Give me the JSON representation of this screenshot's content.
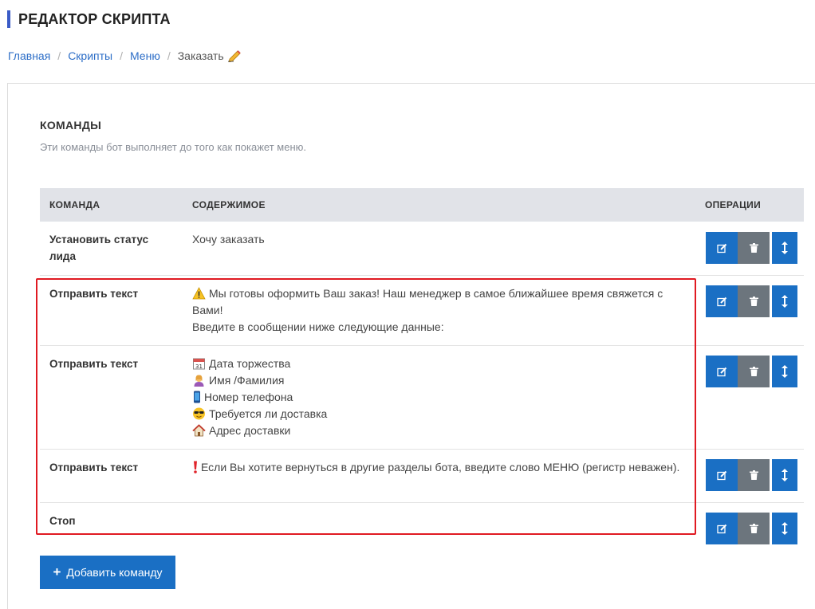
{
  "page": {
    "title": "РЕДАКТОР СКРИПТА"
  },
  "breadcrumb": {
    "items": [
      "Главная",
      "Скрипты",
      "Меню"
    ],
    "current": "Заказать",
    "current_icon": "writing-hand-icon"
  },
  "section": {
    "title": "КОМАНДЫ",
    "description": "Эти команды бот выполняет до того как покажет меню."
  },
  "table": {
    "headers": {
      "command": "КОМАНДА",
      "content": "СОДЕРЖИМОЕ",
      "operations": "ОПЕРАЦИИ"
    },
    "rows": [
      {
        "command": "Установить статус лида",
        "content": [
          "Хочу заказать"
        ]
      },
      {
        "command": "Отправить текст",
        "content": [
          "Мы готовы оформить Ваш заказ! Наш менеджер в самое ближайшее время свяжется с Вами!",
          "Введите в сообщении ниже следующие данные:"
        ],
        "icons": [
          "warning-icon"
        ]
      },
      {
        "command": "Отправить текст",
        "content": [
          "Дата торжества",
          "Имя /Фамилия",
          "Номер телефона",
          "Требуется ли доставка",
          "Адрес доставки"
        ],
        "icons": [
          "calendar-icon",
          "person-icon",
          "phone-icon",
          "sunglasses-face-icon",
          "house-icon"
        ]
      },
      {
        "command": "Отправить текст",
        "content": [
          "Если Вы хотите вернуться в другие разделы бота, введите слово МЕНЮ (регистр неважен)."
        ],
        "icons": [
          "exclamation-icon"
        ]
      },
      {
        "command": "Стоп",
        "content": []
      }
    ],
    "row_actions": [
      "edit-icon",
      "trash-icon",
      "move-icon"
    ]
  },
  "add_button": {
    "label": "Добавить команду",
    "icon": "plus-icon"
  },
  "colors": {
    "accent": "#1a6fc4",
    "gray_button": "#6c757d",
    "highlight": "#e01a22",
    "title_bar": "#3a5bc7",
    "header_bg": "#e1e3e8"
  }
}
